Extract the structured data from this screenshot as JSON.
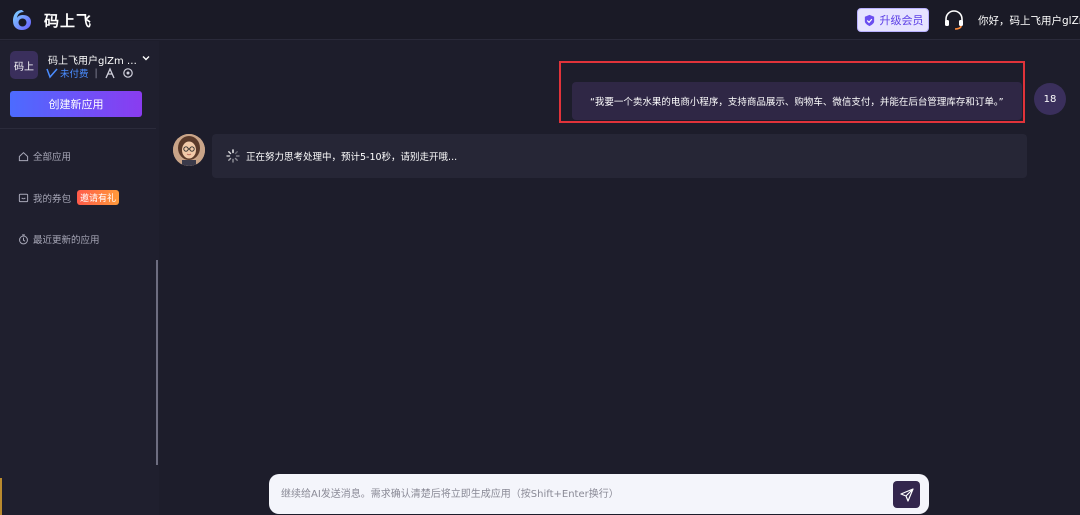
{
  "header": {
    "app_title": "码上飞",
    "upgrade_label": "升级会员",
    "greeting": "你好，码上飞用户glZm"
  },
  "sidebar": {
    "avatar_text": "码上",
    "user_name": "码上飞用户glZm …",
    "status": "未付费",
    "separator": "|",
    "create_button": "创建新应用",
    "items": [
      {
        "label": "全部应用",
        "icon": "home-icon"
      },
      {
        "label": "我的券包",
        "icon": "wallet-icon",
        "badge": "邀请有礼"
      },
      {
        "label": "最近更新的应用",
        "icon": "clock-icon"
      }
    ]
  },
  "chat": {
    "user_message": "“我要一个卖水果的电商小程序，支持商品展示、购物车、微信支付，并能在后台管理库存和订单。”",
    "user_avatar_text": "18",
    "bot_message": "正在努力思考处理中，预计5-10秒，请别走开哦..."
  },
  "input": {
    "placeholder": "继续给AI发送消息。需求确认清楚后将立即生成应用（按Shift+Enter换行）",
    "value": ""
  },
  "colors": {
    "accent_start": "#4c6bff",
    "accent_end": "#8a3cf0",
    "highlight": "#e0333a",
    "status_blue": "#4a8cff"
  }
}
